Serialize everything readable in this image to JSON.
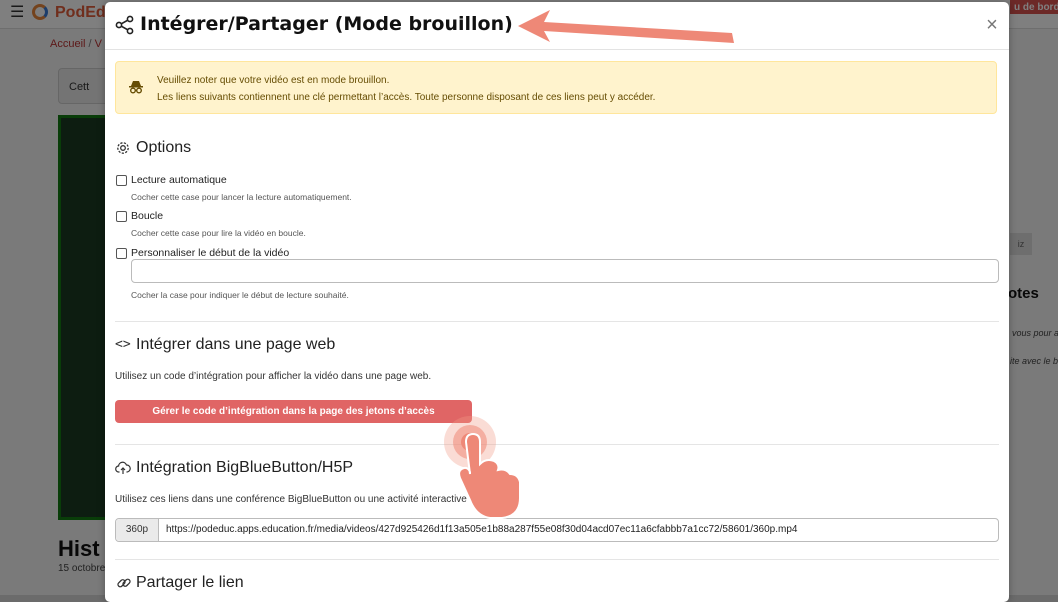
{
  "background": {
    "brand": "PodEd",
    "dashboard_label": "u de bord",
    "breadcrumb_home": "Accueil",
    "breadcrumb_sep": "/",
    "breadcrumb_next": "V",
    "draft_button_label": "Cett",
    "video_title": "Hist",
    "video_date": "15 octobre",
    "side_button_label": "iz",
    "notes_heading": "otes",
    "side_text_1": "vous pour a",
    "side_text_2": "ite avec le bo"
  },
  "modal": {
    "title": "Intégrer/Partager (Mode brouillon)",
    "close_label": "×",
    "alert": {
      "line1": "Veuillez noter que votre vidéo est en mode brouillon.",
      "line2": "Les liens suivants contiennent une clé permettant l’accès. Toute personne disposant de ces liens peut y accéder."
    },
    "options": {
      "heading": "Options",
      "autoplay": {
        "label": "Lecture automatique",
        "help": "Cocher cette case pour lancer la lecture automatiquement.",
        "checked": false
      },
      "loop": {
        "label": "Boucle",
        "help": "Cocher cette case pour lire la vidéo en boucle.",
        "checked": false
      },
      "start": {
        "label": "Personnaliser le début de la vidéo",
        "help": "Cocher la case pour indiquer le début de lecture souhaité.",
        "checked": false,
        "input_value": ""
      }
    },
    "embed": {
      "heading": "Intégrer dans une page web",
      "description": "Utilisez un code d’intégration pour afficher la vidéo dans une page web.",
      "button_label": "Gérer le code d’intégration dans la page des jetons d’accès"
    },
    "bbb": {
      "heading": "Intégration BigBlueButton/H5P",
      "description": "Utilisez ces liens dans une conférence BigBlueButton ou une activité interactive H5P :",
      "quality_label": "360p",
      "url": "https://podeduc.apps.education.fr/media/videos/427d925426d1f13a505e1b88a287f55e08f30d04acd07ec11a6cfabbb7a1cc72/58601/360p.mp4"
    },
    "share": {
      "heading": "Partager le lien"
    }
  },
  "colors": {
    "accent_red": "#e06565",
    "alert_bg": "#fff3cd",
    "annotation": "#ee8877"
  }
}
